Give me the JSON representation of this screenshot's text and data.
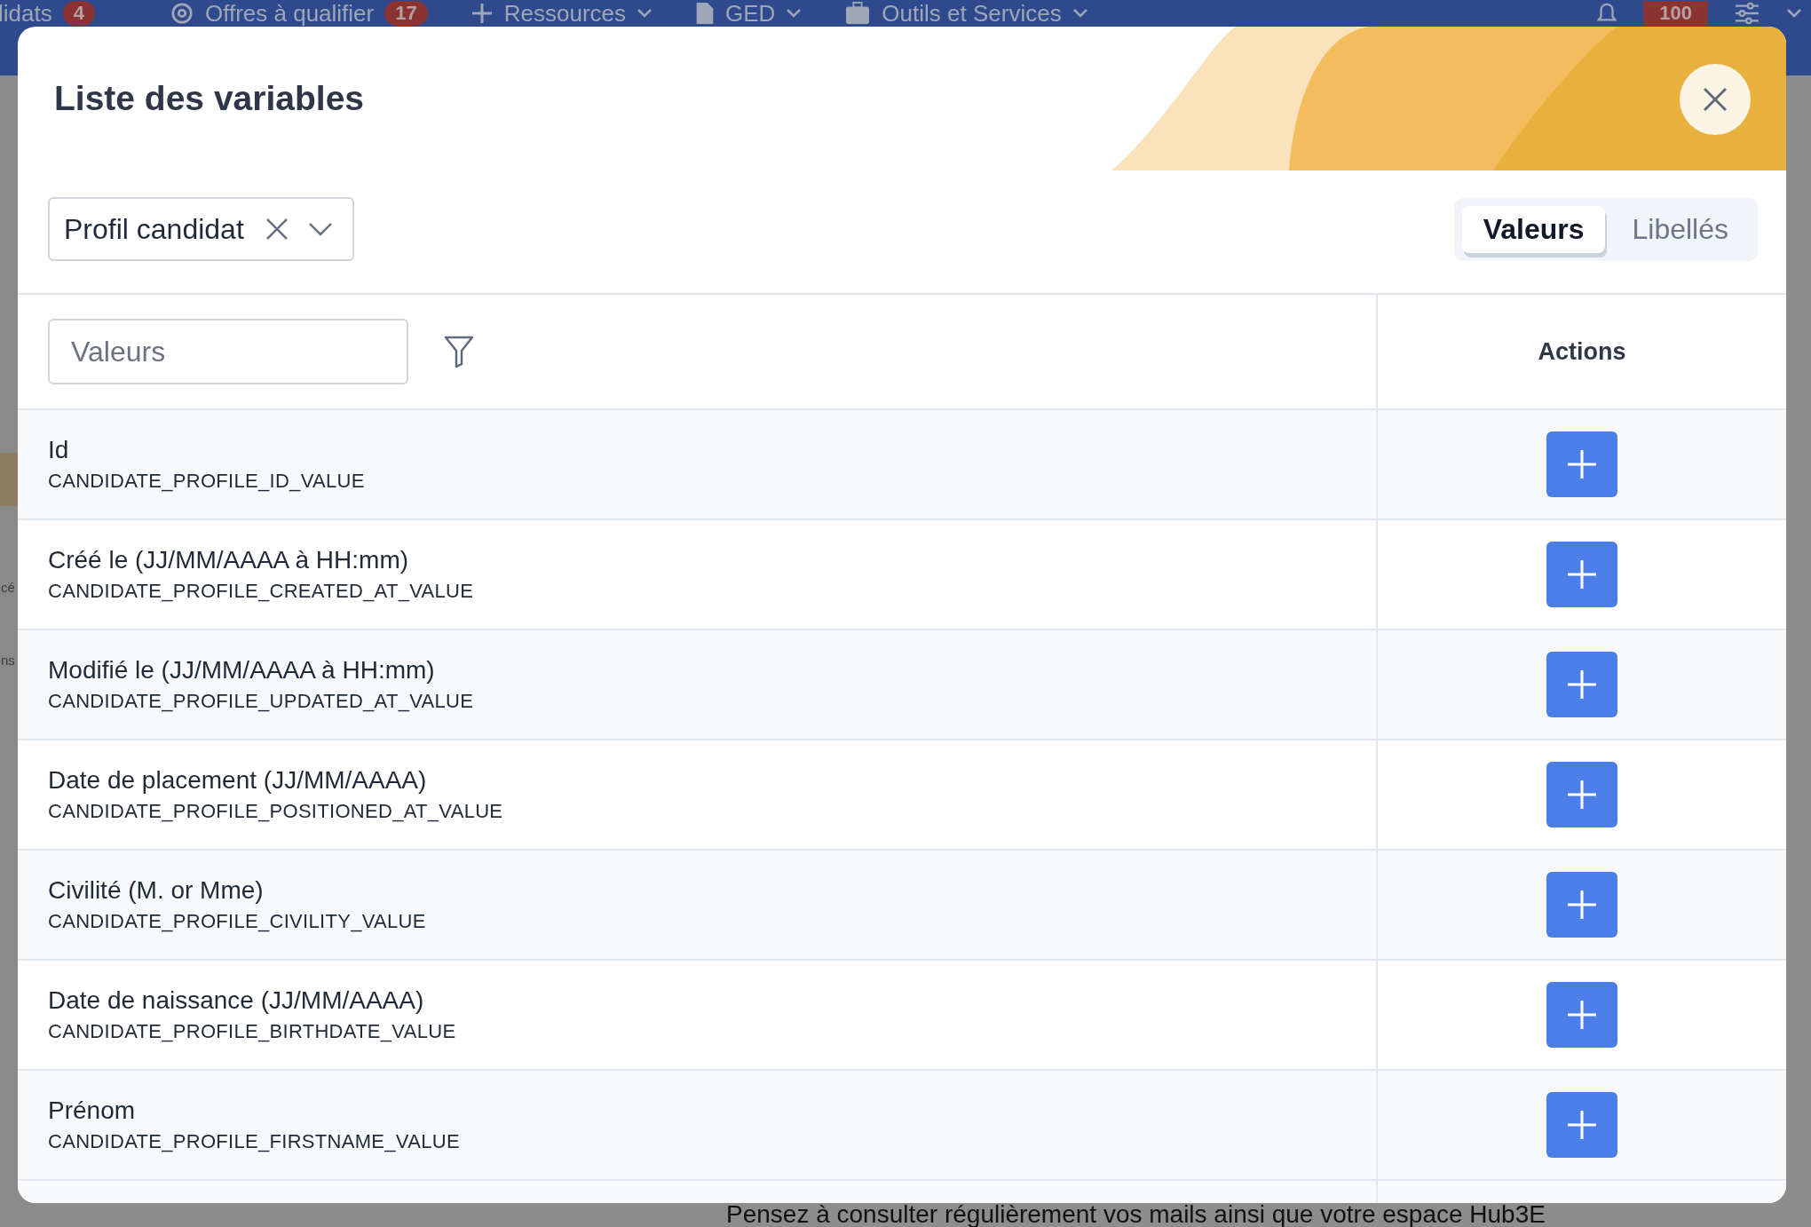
{
  "background": {
    "nav": [
      {
        "kind": "text",
        "label": "lidats",
        "badge": "4"
      },
      {
        "kind": "target",
        "label": "Offres à qualifier",
        "badge": "17"
      },
      {
        "kind": "plus",
        "label": "Ressources"
      },
      {
        "kind": "doc",
        "label": "GED"
      },
      {
        "kind": "case",
        "label": "Outils et Services"
      }
    ],
    "notifications_badge": "100",
    "sidebar_fragments": [
      "cé",
      "ns"
    ],
    "notice": "Pensez à consulter régulièrement vos mails ainsi que votre espace Hub3E"
  },
  "modal": {
    "title": "Liste des variables",
    "category_select": {
      "value": "Profil candidat"
    },
    "view_toggle": [
      {
        "label": "Valeurs",
        "selected": true
      },
      {
        "label": "Libellés",
        "selected": false
      }
    ],
    "search": {
      "placeholder": "Valeurs"
    },
    "actions_header": "Actions",
    "rows": [
      {
        "name": "Id",
        "code": "CANDIDATE_PROFILE_ID_VALUE"
      },
      {
        "name": "Créé le (JJ/MM/AAAA à HH:mm)",
        "code": "CANDIDATE_PROFILE_CREATED_AT_VALUE"
      },
      {
        "name": "Modifié le (JJ/MM/AAAA à HH:mm)",
        "code": "CANDIDATE_PROFILE_UPDATED_AT_VALUE"
      },
      {
        "name": "Date de placement (JJ/MM/AAAA)",
        "code": "CANDIDATE_PROFILE_POSITIONED_AT_VALUE"
      },
      {
        "name": "Civilité (M. or Mme)",
        "code": "CANDIDATE_PROFILE_CIVILITY_VALUE"
      },
      {
        "name": "Date de naissance (JJ/MM/AAAA)",
        "code": "CANDIDATE_PROFILE_BIRTHDATE_VALUE"
      },
      {
        "name": "Prénom",
        "code": "CANDIDATE_PROFILE_FIRSTNAME_VALUE"
      }
    ]
  }
}
